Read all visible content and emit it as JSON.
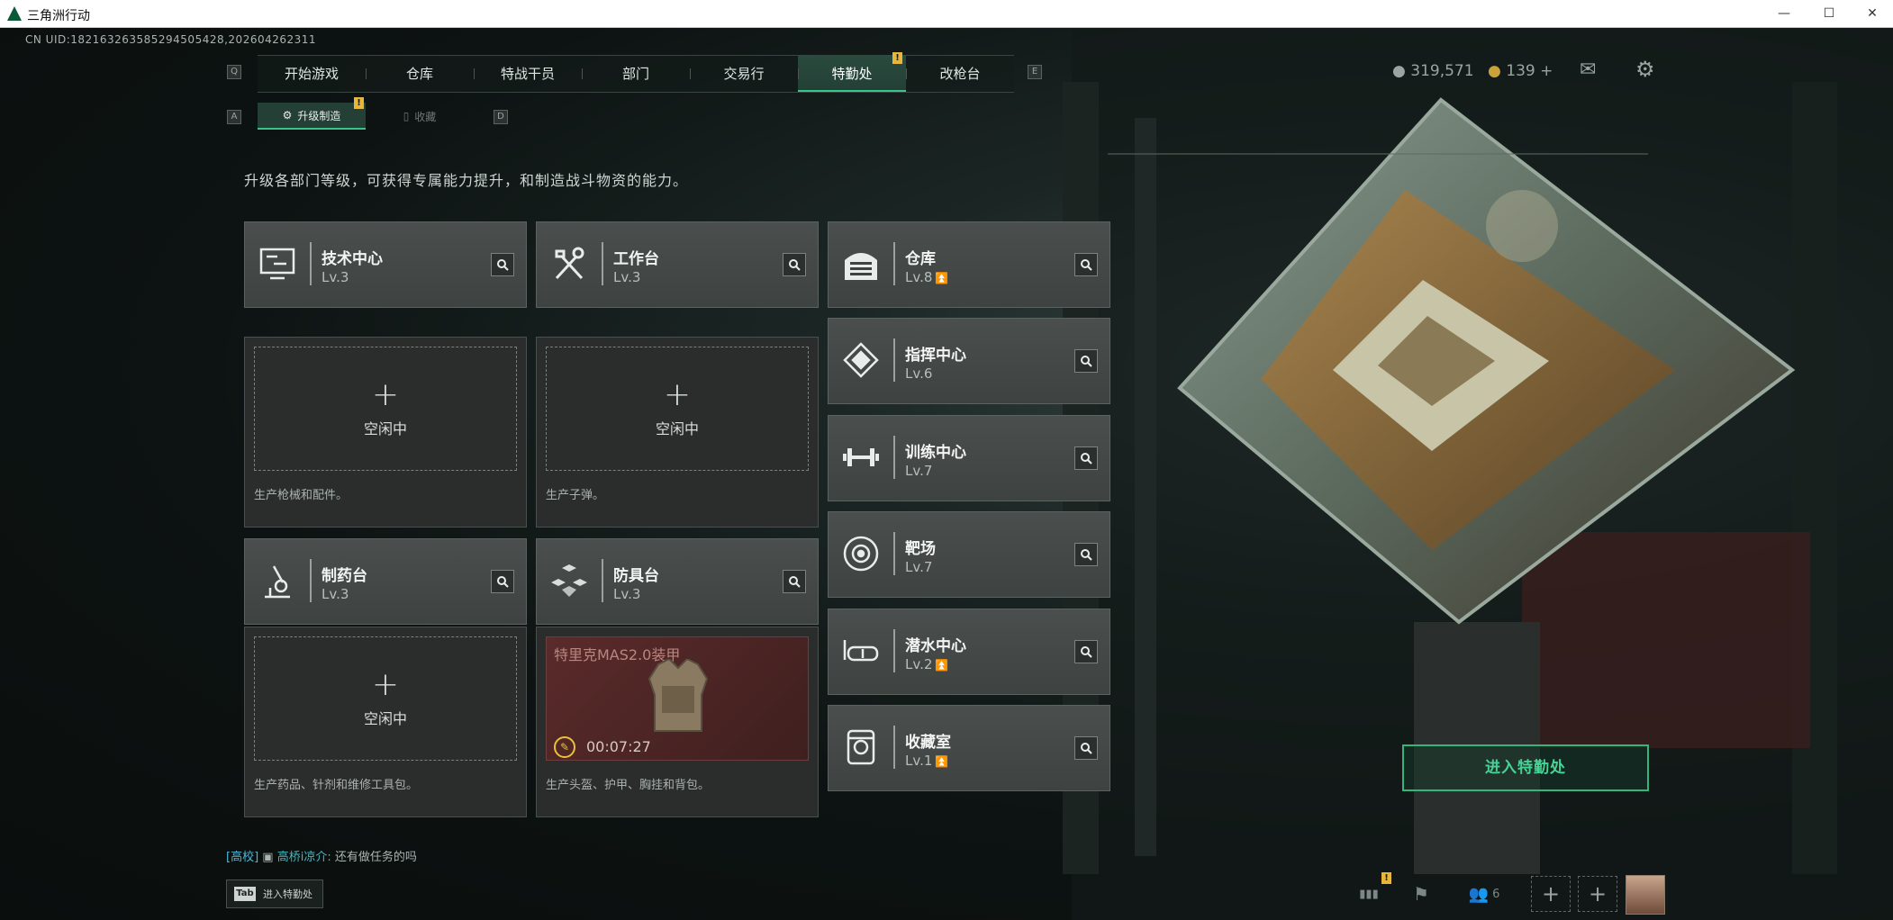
{
  "window": {
    "title": "三角洲行动",
    "min": "—",
    "max": "☐",
    "close": "✕"
  },
  "uid": "CN UID:182163263585294505428,202604262311",
  "key_hints": {
    "left_tab": "Q",
    "right_tab": "E",
    "left_sub": "A",
    "right_sub": "D"
  },
  "tabs": [
    {
      "label": "开始游戏"
    },
    {
      "label": "仓库"
    },
    {
      "label": "特战干员"
    },
    {
      "label": "部门"
    },
    {
      "label": "交易行"
    },
    {
      "label": "特勤处",
      "badge": "!"
    },
    {
      "label": "改枪台"
    }
  ],
  "subtabs": [
    {
      "label": "升级制造",
      "badge": "!"
    },
    {
      "label": "收藏"
    }
  ],
  "description": "升级各部门等级，可获得专属能力提升，和制造战斗物资的能力。",
  "facilities": {
    "tech": {
      "name": "技术中心",
      "level": "Lv.3"
    },
    "workbench": {
      "name": "工作台",
      "level": "Lv.3"
    },
    "warehouse": {
      "name": "仓库",
      "level": "Lv.8"
    },
    "command": {
      "name": "指挥中心",
      "level": "Lv.6"
    },
    "training": {
      "name": "训练中心",
      "level": "Lv.7"
    },
    "pharmacy": {
      "name": "制药台",
      "level": "Lv.3"
    },
    "armor": {
      "name": "防具台",
      "level": "Lv.3"
    },
    "range": {
      "name": "靶场",
      "level": "Lv.7"
    },
    "diving": {
      "name": "潜水中心",
      "level": "Lv.2"
    },
    "collection": {
      "name": "收藏室",
      "level": "Lv.1"
    }
  },
  "slots": {
    "tech": {
      "idle": "空闲中",
      "footer": "生产枪械和配件。"
    },
    "workbench": {
      "idle": "空闲中",
      "footer": "生产子弹。"
    },
    "pharmacy": {
      "idle": "空闲中",
      "footer": "生产药品、针剂和维修工具包。"
    },
    "armor": {
      "product": "特里克MAS2.0装甲",
      "timer": "00:07:27",
      "footer": "生产头盔、护甲、胸挂和背包。"
    }
  },
  "currency": {
    "coins": "319,571",
    "tickets": "139",
    "plus": "+"
  },
  "enter_button": "进入特勤处",
  "chat": {
    "tag": "[高校]",
    "name": "高桥i凉介:",
    "message": "还有做任务的吗"
  },
  "tab_hint": {
    "key": "Tab",
    "label": "进入特勤处"
  },
  "friends_count": "6",
  "bottom_badge": "!",
  "colors": {
    "accent": "#39c48a",
    "badge": "#e8b73a",
    "active_tab": "#244036"
  }
}
